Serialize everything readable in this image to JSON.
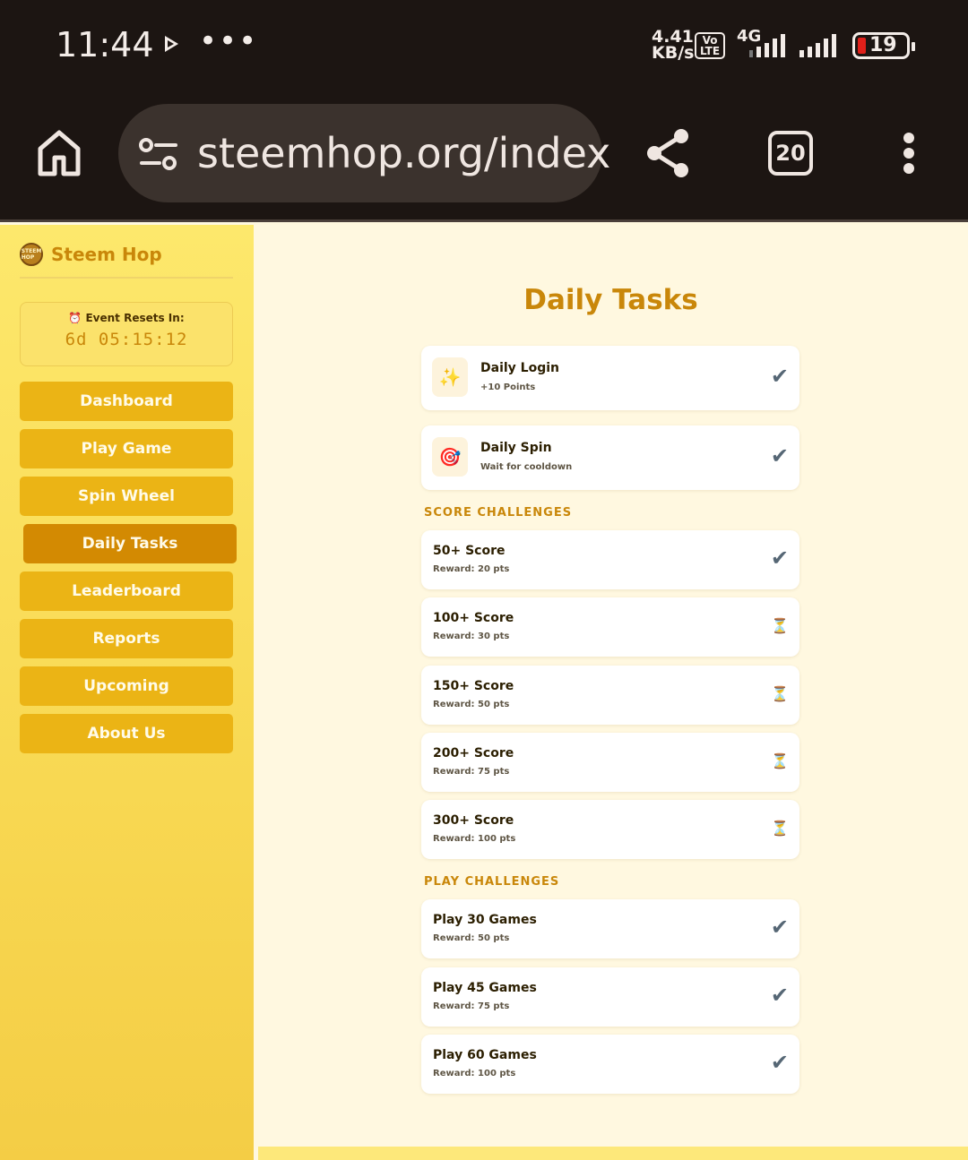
{
  "status_bar": {
    "time": "11:44",
    "dots": "•••",
    "speed_value": "4.41",
    "speed_unit": "KB/s",
    "volte_top": "Vo",
    "volte_bottom": "LTE",
    "network": "4G",
    "battery": "19"
  },
  "browser": {
    "url": "steemhop.org/index",
    "tab_count": "20"
  },
  "sidebar": {
    "brand": "Steem Hop",
    "brand_logo_text": "STEEM HOP",
    "event_label": "⏰ Event Resets In:",
    "event_time": "6d 05:15:12",
    "nav": [
      {
        "label": "Dashboard",
        "active": false
      },
      {
        "label": "Play Game",
        "active": false
      },
      {
        "label": "Spin Wheel",
        "active": false
      },
      {
        "label": "Daily Tasks",
        "active": true
      },
      {
        "label": "Leaderboard",
        "active": false
      },
      {
        "label": "Reports",
        "active": false
      },
      {
        "label": "Upcoming",
        "active": false
      },
      {
        "label": "About Us",
        "active": false
      }
    ]
  },
  "main": {
    "title": "Daily Tasks",
    "daily": [
      {
        "icon": "✨",
        "title": "Daily Login",
        "sub": "+10 Points",
        "status": "✔"
      },
      {
        "icon": "🎯",
        "title": "Daily Spin",
        "sub": "Wait for cooldown",
        "status": "✔"
      }
    ],
    "score_heading": "SCORE CHALLENGES",
    "score": [
      {
        "title": "50+ Score",
        "sub": "Reward: 20 pts",
        "status": "✔"
      },
      {
        "title": "100+ Score",
        "sub": "Reward: 30 pts",
        "status": "⏳"
      },
      {
        "title": "150+ Score",
        "sub": "Reward: 50 pts",
        "status": "⏳"
      },
      {
        "title": "200+ Score",
        "sub": "Reward: 75 pts",
        "status": "⏳"
      },
      {
        "title": "300+ Score",
        "sub": "Reward: 100 pts",
        "status": "⏳"
      }
    ],
    "play_heading": "PLAY CHALLENGES",
    "play": [
      {
        "title": "Play 30 Games",
        "sub": "Reward: 50 pts",
        "status": "✔"
      },
      {
        "title": "Play 45 Games",
        "sub": "Reward: 75 pts",
        "status": "✔"
      },
      {
        "title": "Play 60 Games",
        "sub": "Reward: 100 pts",
        "status": "✔"
      }
    ]
  }
}
